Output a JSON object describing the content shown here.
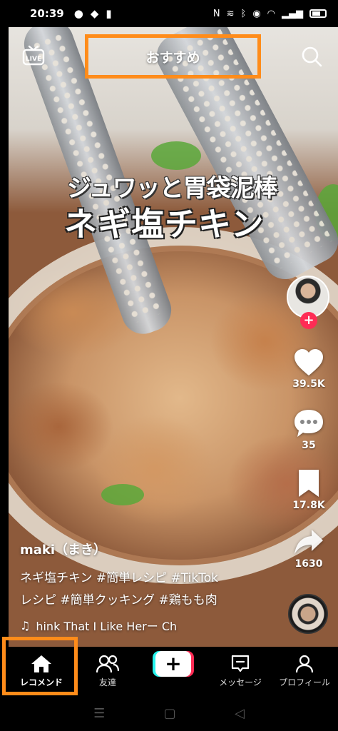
{
  "status_bar": {
    "time": "20:39",
    "left_icons": [
      "chat-bubble-icon",
      "dropbox-icon",
      "keyhole-icon"
    ],
    "right_icons": [
      "nfc-off-icon",
      "vibrate-icon",
      "bluetooth-icon",
      "location-icon",
      "wifi-icon",
      "signal-icon",
      "battery-icon"
    ]
  },
  "top_bar": {
    "tab_label": "おすすめ",
    "live_icon": "live-tv-icon",
    "search_icon": "search-icon"
  },
  "video": {
    "caption_line1": "ジュワッと胃袋泥棒",
    "caption_line2": "ネギ塩チキン"
  },
  "actions": {
    "likes": "39.5K",
    "comments": "35",
    "saves": "17.8K",
    "shares": "1630"
  },
  "meta": {
    "username": "maki（まき）",
    "description_line1": "ネギ塩チキン #簡単レシピ #TikTok",
    "description_line2": "レシピ #簡単クッキング #鶏もも肉",
    "music": "hink That I Like Herー Ch"
  },
  "bottom_nav": {
    "items": [
      {
        "label": "レコメンド",
        "icon": "home-icon"
      },
      {
        "label": "友達",
        "icon": "friends-icon"
      },
      {
        "label": "+",
        "icon": "create-icon"
      },
      {
        "label": "メッセージ",
        "icon": "message-icon"
      },
      {
        "label": "プロフィール",
        "icon": "profile-icon"
      }
    ]
  },
  "system_nav": {
    "recents": "☰",
    "home": "▢",
    "back": "◁"
  },
  "colors": {
    "highlight": "#ff8c1a",
    "follow_red": "#fe2c55",
    "create_cyan": "#25f4ee"
  }
}
